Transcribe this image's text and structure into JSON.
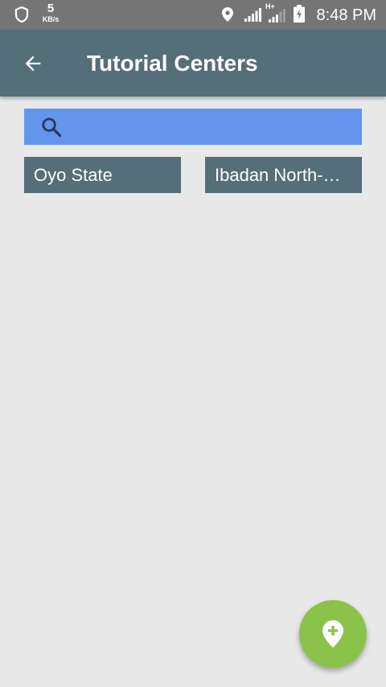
{
  "status_bar": {
    "speed_value": "5",
    "speed_unit": "KB/s",
    "network_type": "H+",
    "time": "8:48 PM"
  },
  "app_bar": {
    "title": "Tutorial Centers",
    "background_color": "#546e7a"
  },
  "search": {
    "value": "",
    "placeholder": "",
    "background_color": "#6495ed"
  },
  "filters": {
    "state": "Oyo State",
    "lga": "Ibadan North-East"
  },
  "fab": {
    "icon": "add-location-icon",
    "color": "#8bc34a"
  },
  "icons": {
    "back": "arrow-back-icon",
    "search": "search-icon"
  }
}
